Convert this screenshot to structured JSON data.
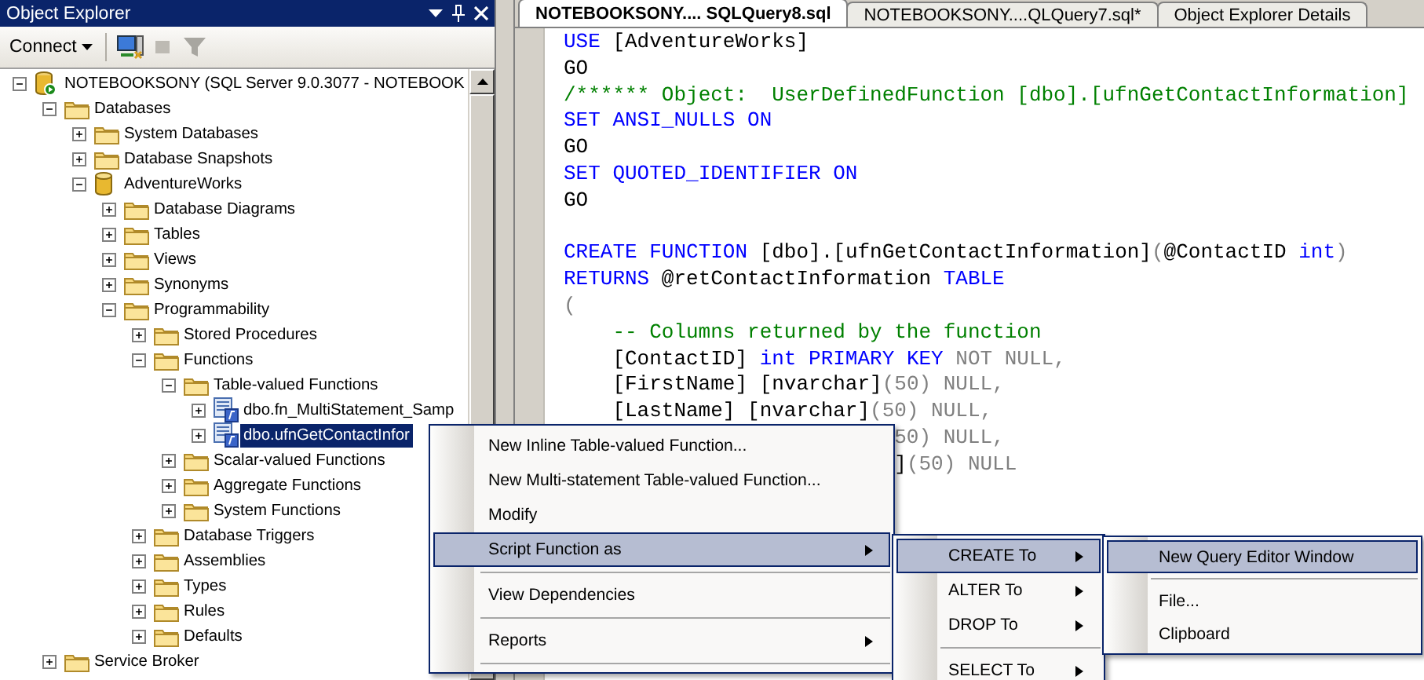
{
  "object_explorer": {
    "title": "Object Explorer",
    "connect": "Connect"
  },
  "tree": [
    {
      "label": "NOTEBOOKSONY (SQL Server 9.0.3077 - NOTEBOOK",
      "kind": "server",
      "expanded": true,
      "selected": false,
      "children": [
        {
          "label": "Databases",
          "kind": "folder",
          "expanded": true,
          "selected": false,
          "children": [
            {
              "label": "System Databases",
              "kind": "folder",
              "expanded": false,
              "selected": false
            },
            {
              "label": "Database Snapshots",
              "kind": "folder",
              "expanded": false,
              "selected": false
            },
            {
              "label": "AdventureWorks",
              "kind": "database",
              "expanded": true,
              "selected": false,
              "children": [
                {
                  "label": "Database Diagrams",
                  "kind": "folder",
                  "expanded": false,
                  "selected": false
                },
                {
                  "label": "Tables",
                  "kind": "folder",
                  "expanded": false,
                  "selected": false
                },
                {
                  "label": "Views",
                  "kind": "folder",
                  "expanded": false,
                  "selected": false
                },
                {
                  "label": "Synonyms",
                  "kind": "folder",
                  "expanded": false,
                  "selected": false
                },
                {
                  "label": "Programmability",
                  "kind": "folder",
                  "expanded": true,
                  "selected": false,
                  "children": [
                    {
                      "label": "Stored Procedures",
                      "kind": "folder",
                      "expanded": false,
                      "selected": false
                    },
                    {
                      "label": "Functions",
                      "kind": "folder",
                      "expanded": true,
                      "selected": false,
                      "children": [
                        {
                          "label": "Table-valued Functions",
                          "kind": "folder",
                          "expanded": true,
                          "selected": false,
                          "children": [
                            {
                              "label": "dbo.fn_MultiStatement_Samp",
                              "kind": "function",
                              "expanded": false,
                              "selected": false
                            },
                            {
                              "label": "dbo.ufnGetContactInfor",
                              "kind": "function",
                              "expanded": false,
                              "selected": true
                            }
                          ]
                        },
                        {
                          "label": "Scalar-valued Functions",
                          "kind": "folder",
                          "expanded": false,
                          "selected": false
                        },
                        {
                          "label": "Aggregate Functions",
                          "kind": "folder",
                          "expanded": false,
                          "selected": false
                        },
                        {
                          "label": "System Functions",
                          "kind": "folder",
                          "expanded": false,
                          "selected": false
                        }
                      ]
                    },
                    {
                      "label": "Database Triggers",
                      "kind": "folder",
                      "expanded": false,
                      "selected": false
                    },
                    {
                      "label": "Assemblies",
                      "kind": "folder",
                      "expanded": false,
                      "selected": false
                    },
                    {
                      "label": "Types",
                      "kind": "folder",
                      "expanded": false,
                      "selected": false
                    },
                    {
                      "label": "Rules",
                      "kind": "folder",
                      "expanded": false,
                      "selected": false
                    },
                    {
                      "label": "Defaults",
                      "kind": "folder",
                      "expanded": false,
                      "selected": false
                    }
                  ]
                }
              ]
            }
          ]
        },
        {
          "label": "Service Broker",
          "kind": "folder",
          "expanded": false,
          "selected": false
        }
      ]
    }
  ],
  "editor": {
    "tabs": [
      {
        "label": "NOTEBOOKSONY.... SQLQuery8.sql",
        "selected": true
      },
      {
        "label": "NOTEBOOKSONY....QLQuery7.sql*",
        "selected": false
      },
      {
        "label": "Object Explorer Details",
        "selected": false
      }
    ],
    "lines": [
      {
        "kind": "code",
        "indented": false,
        "segments": [
          {
            "kind": "keyword",
            "text": "USE"
          },
          {
            "kind": "plain",
            "text": " [AdventureWorks]"
          }
        ]
      },
      {
        "kind": "code",
        "indented": false,
        "segments": [
          {
            "kind": "plain",
            "text": "GO"
          }
        ]
      },
      {
        "kind": "code",
        "indented": false,
        "segments": [
          {
            "kind": "comment",
            "text": "/****** Object:  UserDefinedFunction [dbo].[ufnGetContactInformation]"
          }
        ]
      },
      {
        "kind": "code",
        "indented": false,
        "segments": [
          {
            "kind": "keyword",
            "text": "SET ANSI_NULLS ON"
          }
        ]
      },
      {
        "kind": "code",
        "indented": false,
        "segments": [
          {
            "kind": "plain",
            "text": "GO"
          }
        ]
      },
      {
        "kind": "code",
        "indented": false,
        "segments": [
          {
            "kind": "keyword",
            "text": "SET QUOTED_IDENTIFIER ON"
          }
        ]
      },
      {
        "kind": "code",
        "indented": false,
        "segments": [
          {
            "kind": "plain",
            "text": "GO"
          }
        ]
      },
      {
        "kind": "blank"
      },
      {
        "kind": "code",
        "indented": false,
        "segments": [
          {
            "kind": "keyword",
            "text": "CREATE FUNCTION"
          },
          {
            "kind": "plain",
            "text": " [dbo].[ufnGetContactInformation]"
          },
          {
            "kind": "gray",
            "text": "("
          },
          {
            "kind": "plain",
            "text": "@ContactID "
          },
          {
            "kind": "keyword",
            "text": "int"
          },
          {
            "kind": "gray",
            "text": ")"
          }
        ]
      },
      {
        "kind": "code",
        "indented": false,
        "segments": [
          {
            "kind": "keyword",
            "text": "RETURNS"
          },
          {
            "kind": "plain",
            "text": " @retContactInformation "
          },
          {
            "kind": "keyword",
            "text": "TABLE"
          }
        ]
      },
      {
        "kind": "code",
        "indented": false,
        "segments": [
          {
            "kind": "gray",
            "text": "("
          }
        ]
      },
      {
        "kind": "code",
        "indented": true,
        "segments": [
          {
            "kind": "comment",
            "text": "-- Columns returned by the function"
          }
        ]
      },
      {
        "kind": "code",
        "indented": true,
        "segments": [
          {
            "kind": "plain",
            "text": "[ContactID] "
          },
          {
            "kind": "keyword",
            "text": "int PRIMARY KEY"
          },
          {
            "kind": "gray",
            "text": " NOT NULL,"
          }
        ]
      },
      {
        "kind": "code",
        "indented": true,
        "segments": [
          {
            "kind": "plain",
            "text": "[FirstName] [nvarchar]"
          },
          {
            "kind": "gray",
            "text": "(50) NULL,"
          }
        ]
      },
      {
        "kind": "code",
        "indented": true,
        "segments": [
          {
            "kind": "plain",
            "text": "[LastName] [nvarchar]"
          },
          {
            "kind": "gray",
            "text": "(50) NULL,"
          }
        ]
      },
      {
        "kind": "clipped",
        "indented": true,
        "segments": [
          {
            "kind": "gray",
            "text": "50) NULL,"
          }
        ]
      },
      {
        "kind": "clipped",
        "indented": true,
        "segments": [
          {
            "kind": "plain",
            "text": "]"
          },
          {
            "kind": "gray",
            "text": "(50) NULL"
          }
        ]
      }
    ]
  },
  "context_menu": [
    {
      "kind": "item",
      "label": "New Inline Table-valued Function...",
      "submenu": false,
      "selected": false
    },
    {
      "kind": "item",
      "label": "New Multi-statement Table-valued Function...",
      "submenu": false,
      "selected": false
    },
    {
      "kind": "item",
      "label": "Modify",
      "submenu": false,
      "selected": false
    },
    {
      "kind": "item",
      "label": "Script Function as",
      "submenu": true,
      "selected": true
    },
    {
      "kind": "separator"
    },
    {
      "kind": "item",
      "label": "View Dependencies",
      "submenu": false,
      "selected": false
    },
    {
      "kind": "separator"
    },
    {
      "kind": "item",
      "label": "Reports",
      "submenu": true,
      "selected": false
    },
    {
      "kind": "separator"
    }
  ],
  "script_submenu": [
    {
      "kind": "item",
      "label": "CREATE To",
      "submenu": true,
      "selected": true
    },
    {
      "kind": "item",
      "label": "ALTER To",
      "submenu": true,
      "selected": false
    },
    {
      "kind": "item",
      "label": "DROP To",
      "submenu": true,
      "selected": false
    },
    {
      "kind": "separator"
    },
    {
      "kind": "item",
      "label": "SELECT To",
      "submenu": true,
      "selected": false
    }
  ],
  "create_submenu": [
    {
      "kind": "item",
      "label": "New Query Editor Window",
      "submenu": false,
      "selected": true
    },
    {
      "kind": "separator"
    },
    {
      "kind": "item",
      "label": "File...",
      "submenu": false,
      "selected": false
    },
    {
      "kind": "item",
      "label": "Clipboard",
      "submenu": false,
      "selected": false
    }
  ]
}
